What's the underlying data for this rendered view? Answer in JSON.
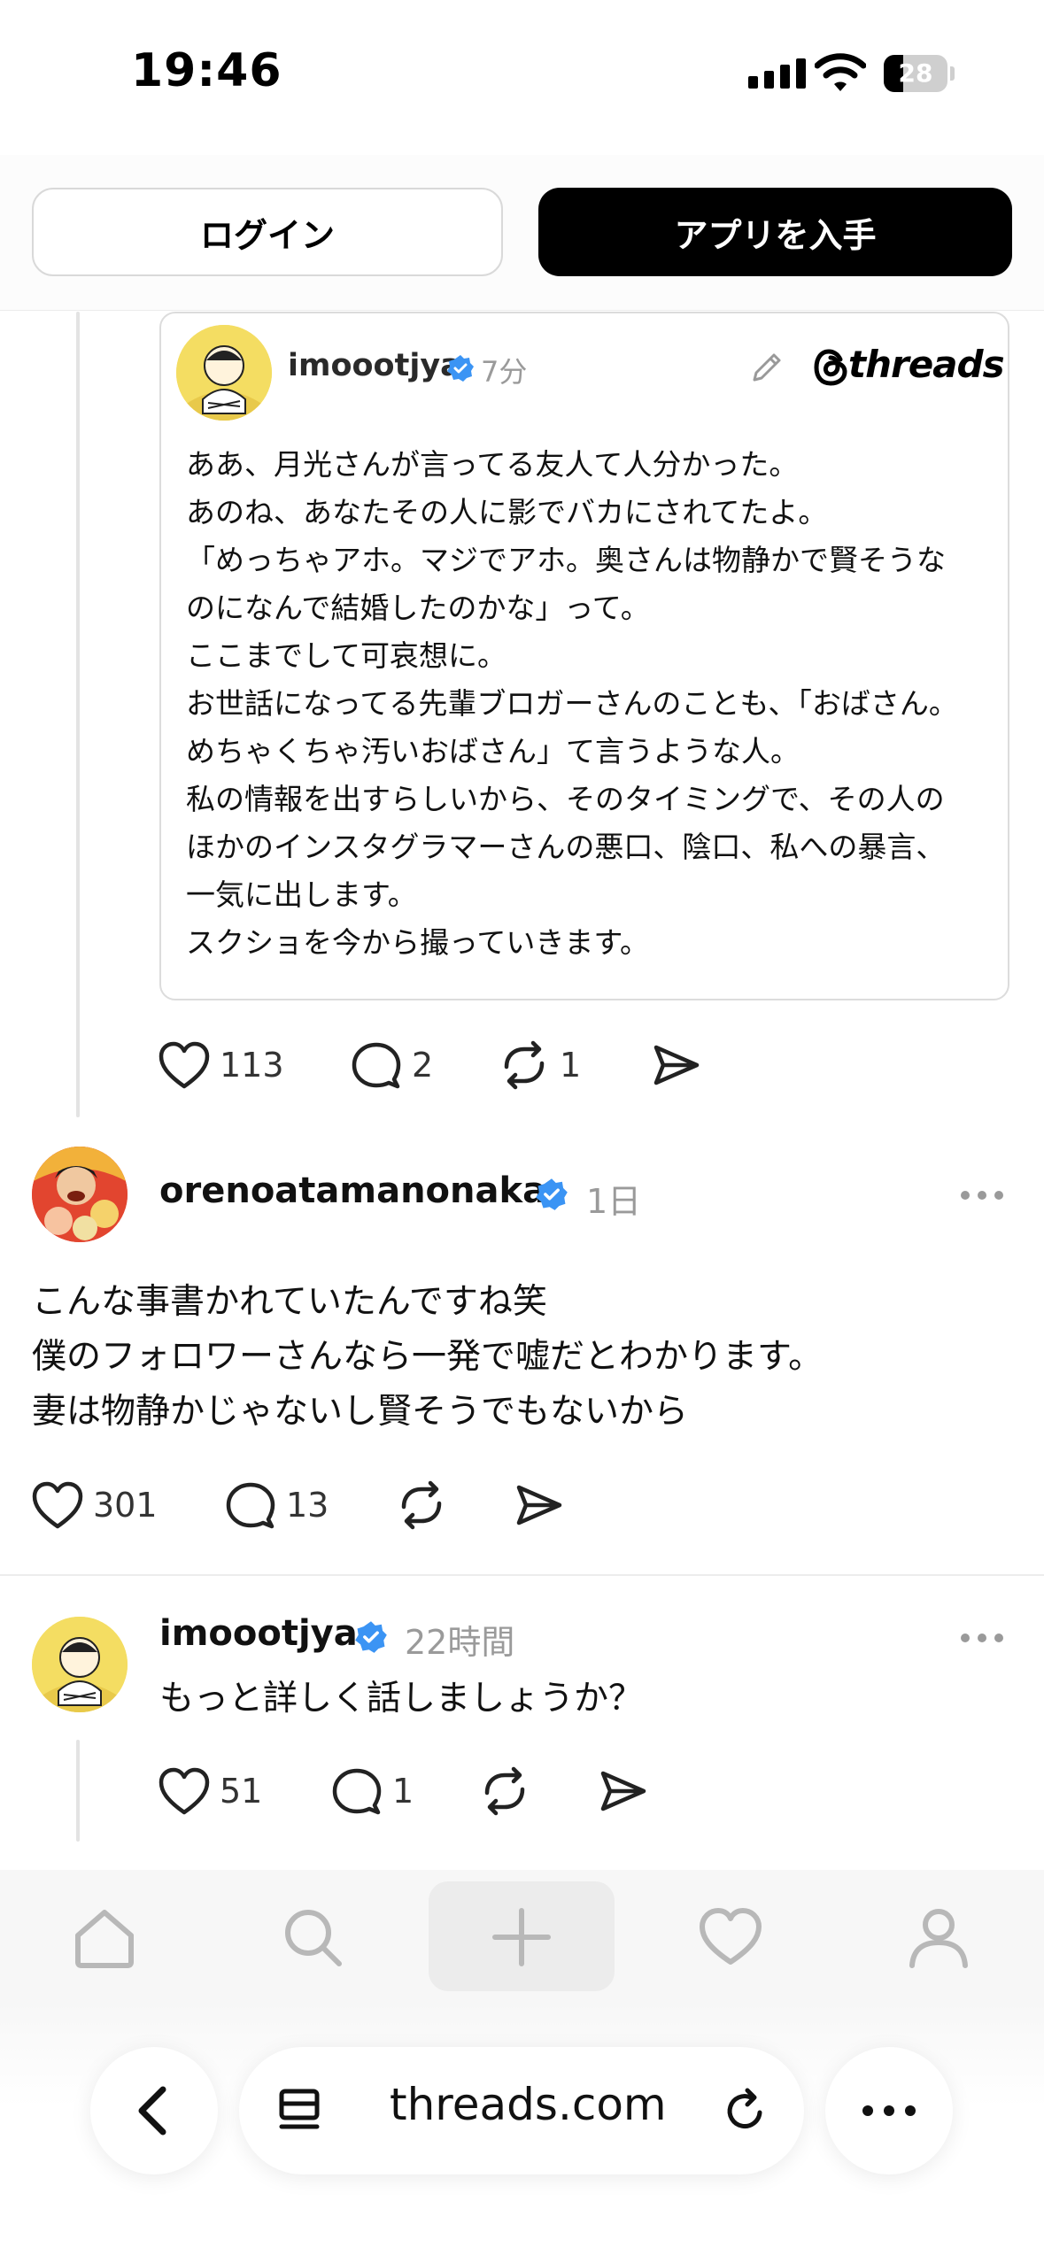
{
  "status_bar": {
    "time": "19:46",
    "battery": "28"
  },
  "header": {
    "login": "ログイン",
    "get_app": "アプリを入手"
  },
  "quote_card": {
    "username": "imoootjya",
    "time": "7分",
    "brand": "threads",
    "lines": [
      "ああ、月光さんが言ってる友人て人分かった。",
      "あのね、あなたその人に影でバカにされてたよ。",
      "「めっちゃアホ。マジでアホ。奥さんは物静かで賢そうな",
      "のになんで結婚したのかな」って。",
      "ここまでして可哀想に。",
      "お世話になってる先輩ブロガーさんのことも、「おばさん。",
      "めちゃくちゃ汚いおばさん」て言うような人。",
      "私の情報を出すらしいから、そのタイミングで、その人の",
      "ほかのインスタグラマーさんの悪口、陰口、私への暴言、",
      "一気に出します。",
      "スクショを今から撮っていきます。"
    ]
  },
  "post1_actions": {
    "likes": "113",
    "replies": "2",
    "reposts": "1"
  },
  "post2": {
    "username": "orenoatamanonaka",
    "time": "1日",
    "lines": [
      "こんな事書かれていたんですね笑",
      "僕のフォロワーさんなら一発で嘘だとわかります。",
      "妻は物静かじゃないし賢そうでもないから"
    ],
    "likes": "301",
    "replies": "13"
  },
  "post3": {
    "username": "imoootjya",
    "time": "22時間",
    "text": "もっと詳しく話しましょうか？",
    "likes": "51",
    "replies": "1"
  },
  "bottom_nav": [
    "home-icon",
    "search-icon",
    "plus-icon",
    "heart-icon",
    "profile-icon"
  ],
  "browser": {
    "url": "threads.com"
  },
  "colors": {
    "verified": "#3b94f4",
    "muted": "#9a9a9a",
    "button_dark": "#000000"
  }
}
